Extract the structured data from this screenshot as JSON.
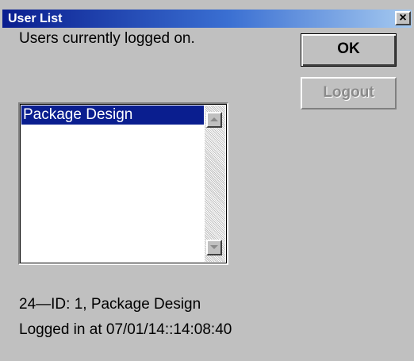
{
  "window": {
    "title": "User List",
    "close_glyph": "×"
  },
  "users_label": "Users currently logged on.",
  "buttons": {
    "ok_label": "OK",
    "logout_label": "Logout",
    "logout_enabled": false
  },
  "user_list": {
    "items": [
      {
        "label": "Package Design",
        "selected": true
      }
    ]
  },
  "details": {
    "id_line": "24—ID: 1, Package Design",
    "login_line": "Logged in at 07/01/14::14:08:40"
  },
  "colors": {
    "face": "#c0c0c0",
    "selection": "#0a1e8f",
    "title_start": "#0a1e8f",
    "title_end": "#a6caf0",
    "disabled_text": "#8a8a8a"
  },
  "icons": {
    "close": "close-icon",
    "scroll_up": "scroll-up-arrow-icon",
    "scroll_down": "scroll-down-arrow-icon"
  }
}
